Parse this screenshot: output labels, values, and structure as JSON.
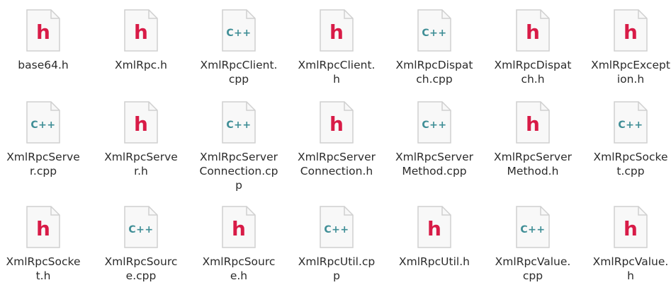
{
  "window": {
    "title": ""
  },
  "colors": {
    "header_accent": "#d81b47",
    "cpp_accent": "#3f8e96",
    "page_fill": "#f8f8f8"
  },
  "files": [
    {
      "name": "base64.h",
      "type": "header"
    },
    {
      "name": "XmlRpc.h",
      "type": "header"
    },
    {
      "name": "XmlRpcClient.cpp",
      "type": "cpp"
    },
    {
      "name": "XmlRpcClient.h",
      "type": "header"
    },
    {
      "name": "XmlRpcDispatch.cpp",
      "type": "cpp"
    },
    {
      "name": "XmlRpcDispatch.h",
      "type": "header"
    },
    {
      "name": "XmlRpcException.h",
      "type": "header"
    },
    {
      "name": "XmlRpcServer.cpp",
      "type": "cpp"
    },
    {
      "name": "XmlRpcServer.h",
      "type": "header"
    },
    {
      "name": "XmlRpcServerConnection.cpp",
      "type": "cpp"
    },
    {
      "name": "XmlRpcServerConnection.h",
      "type": "header"
    },
    {
      "name": "XmlRpcServerMethod.cpp",
      "type": "cpp"
    },
    {
      "name": "XmlRpcServerMethod.h",
      "type": "header"
    },
    {
      "name": "XmlRpcSocket.cpp",
      "type": "cpp"
    },
    {
      "name": "XmlRpcSocket.h",
      "type": "header"
    },
    {
      "name": "XmlRpcSource.cpp",
      "type": "cpp"
    },
    {
      "name": "XmlRpcSource.h",
      "type": "header"
    },
    {
      "name": "XmlRpcUtil.cpp",
      "type": "cpp"
    },
    {
      "name": "XmlRpcUtil.h",
      "type": "header"
    },
    {
      "name": "XmlRpcValue.cpp",
      "type": "cpp"
    },
    {
      "name": "XmlRpcValue.h",
      "type": "header"
    }
  ],
  "icons": {
    "header": {
      "name": "c-header-file-icon",
      "glyph": "h"
    },
    "cpp": {
      "name": "cpp-source-file-icon",
      "glyph": "C++"
    }
  }
}
